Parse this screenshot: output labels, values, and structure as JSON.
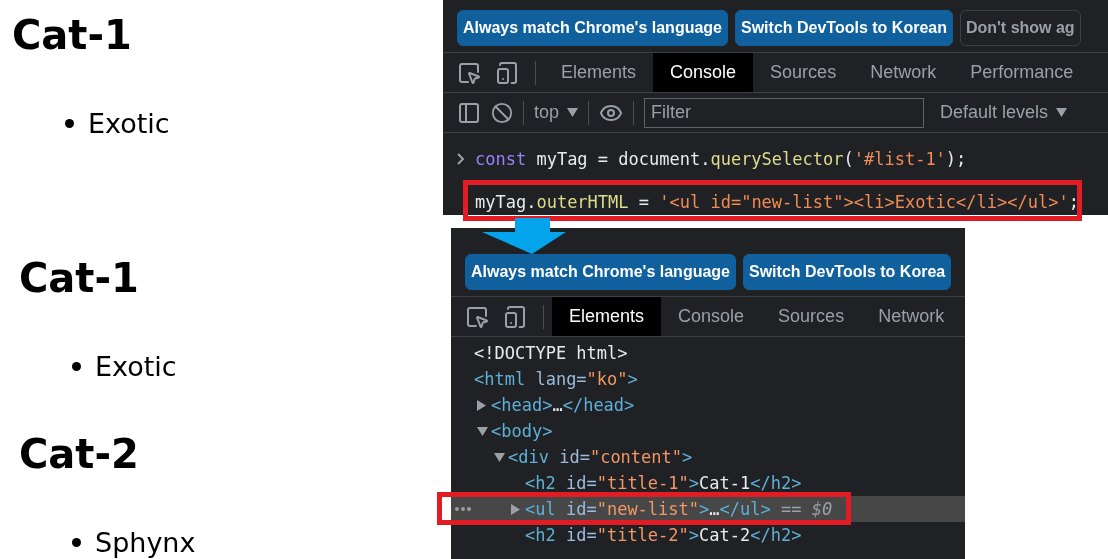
{
  "page_views": [
    {
      "items": [
        {
          "kind": "heading",
          "text": "Cat-1"
        },
        {
          "kind": "bullet",
          "text": "Exotic"
        }
      ]
    },
    {
      "items": [
        {
          "kind": "heading",
          "text": "Cat-1"
        },
        {
          "kind": "bullet",
          "text": "Exotic"
        },
        {
          "kind": "heading",
          "text": "Cat-2"
        },
        {
          "kind": "bullet",
          "text": "Sphynx"
        }
      ]
    }
  ],
  "devtools_panels": [
    {
      "infobar": {
        "buttons": [
          {
            "kind": "primary",
            "label": "Always match Chrome's language"
          },
          {
            "kind": "primary",
            "label": "Switch DevTools to Korean"
          },
          {
            "kind": "outline",
            "label": "Don't show ag"
          }
        ]
      },
      "tabs": [
        {
          "label": "Elements",
          "selected": false
        },
        {
          "label": "Console",
          "selected": true
        },
        {
          "label": "Sources",
          "selected": false
        },
        {
          "label": "Network",
          "selected": false
        },
        {
          "label": "Performance",
          "selected": false
        }
      ],
      "console": {
        "context": "top",
        "filter_placeholder": "Filter",
        "levels": "Default levels",
        "lines": [
          {
            "kind": "prompt",
            "tokens": [
              {
                "kind": "keyword",
                "text": "const"
              },
              {
                "kind": "plain",
                "text": " myTag = document."
              },
              {
                "kind": "method",
                "text": "querySelector"
              },
              {
                "kind": "plain",
                "text": "("
              },
              {
                "kind": "string",
                "text": "'#list-1'"
              },
              {
                "kind": "plain",
                "text": ");"
              }
            ]
          },
          {
            "kind": "continuation",
            "tokens": [
              {
                "kind": "plain",
                "text": "myTag."
              },
              {
                "kind": "method",
                "text": "outerHTML"
              },
              {
                "kind": "plain",
                "text": " = "
              },
              {
                "kind": "string",
                "text": "'<ul id=\"new-list\"><li>Exotic</li></ul>'"
              },
              {
                "kind": "plain",
                "text": ";"
              }
            ]
          }
        ]
      }
    },
    {
      "infobar": {
        "buttons": [
          {
            "kind": "primary",
            "label": "Always match Chrome's language"
          },
          {
            "kind": "primary",
            "label": "Switch DevTools to Korea"
          }
        ]
      },
      "tabs": [
        {
          "label": "Elements",
          "selected": true
        },
        {
          "label": "Console",
          "selected": false
        },
        {
          "label": "Sources",
          "selected": false
        },
        {
          "label": "Network",
          "selected": false
        }
      ],
      "dom_tree": [
        {
          "selected": false,
          "tokens": [
            {
              "kind": "text",
              "text": "<!DOCTYPE html>"
            }
          ]
        },
        {
          "selected": false,
          "tokens": [
            {
              "kind": "tag",
              "text": "<html"
            },
            {
              "kind": "attr",
              "text": " lang="
            },
            {
              "kind": "value",
              "text": "\"ko\""
            },
            {
              "kind": "tag",
              "text": ">"
            }
          ],
          "children": [
            {
              "selected": false,
              "expanded": false,
              "tokens": [
                {
                  "kind": "tag",
                  "text": "<head>"
                },
                {
                  "kind": "text",
                  "text": "…"
                },
                {
                  "kind": "tag",
                  "text": "</head>"
                }
              ]
            },
            {
              "selected": false,
              "expanded": true,
              "tokens": [
                {
                  "kind": "tag",
                  "text": "<body>"
                }
              ],
              "children": [
                {
                  "selected": false,
                  "expanded": true,
                  "tokens": [
                    {
                      "kind": "tag",
                      "text": "<div"
                    },
                    {
                      "kind": "attr",
                      "text": " id="
                    },
                    {
                      "kind": "value",
                      "text": "\"content\""
                    },
                    {
                      "kind": "tag",
                      "text": ">"
                    }
                  ],
                  "children": [
                    {
                      "selected": false,
                      "tokens": [
                        {
                          "kind": "tag",
                          "text": "<h2"
                        },
                        {
                          "kind": "attr",
                          "text": " id="
                        },
                        {
                          "kind": "value",
                          "text": "\"title-1\""
                        },
                        {
                          "kind": "tag",
                          "text": ">"
                        },
                        {
                          "kind": "text",
                          "text": "Cat-1"
                        },
                        {
                          "kind": "tag",
                          "text": "</h2>"
                        }
                      ]
                    },
                    {
                      "selected": true,
                      "expanded": false,
                      "tokens": [
                        {
                          "kind": "tag",
                          "text": "<ul"
                        },
                        {
                          "kind": "attr",
                          "text": " id="
                        },
                        {
                          "kind": "value",
                          "text": "\"new-list\""
                        },
                        {
                          "kind": "tag",
                          "text": ">"
                        },
                        {
                          "kind": "text",
                          "text": "…"
                        },
                        {
                          "kind": "tag",
                          "text": "</ul>"
                        },
                        {
                          "kind": "muted",
                          "text": " == $0"
                        }
                      ]
                    },
                    {
                      "selected": false,
                      "tokens": [
                        {
                          "kind": "tag",
                          "text": "<h2"
                        },
                        {
                          "kind": "attr",
                          "text": " id="
                        },
                        {
                          "kind": "value",
                          "text": "\"title-2\""
                        },
                        {
                          "kind": "tag",
                          "text": ">"
                        },
                        {
                          "kind": "text",
                          "text": "Cat-2"
                        },
                        {
                          "kind": "tag",
                          "text": "</h2>"
                        }
                      ]
                    }
                  ]
                }
              ]
            }
          ]
        }
      ]
    }
  ]
}
